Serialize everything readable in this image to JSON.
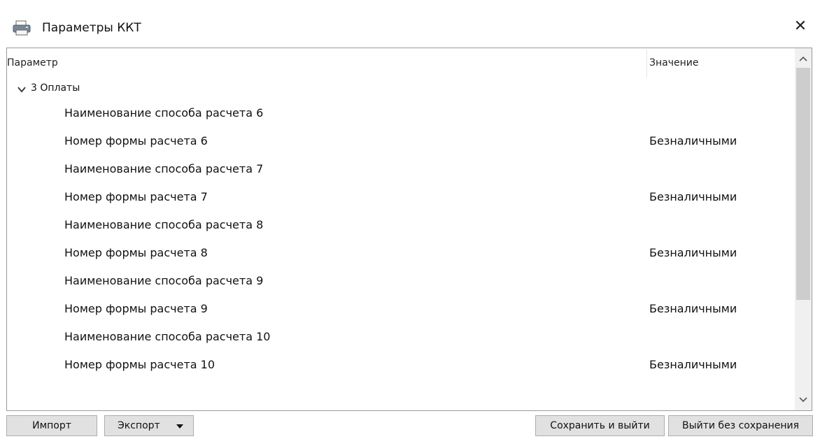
{
  "window": {
    "title": "Параметры ККТ",
    "icon": "printer-icon",
    "close_symbol": "✕"
  },
  "table": {
    "columns": {
      "param": "Параметр",
      "value": "Значение"
    },
    "group": {
      "label": "3 Оплаты",
      "expanded": true
    },
    "rows": [
      {
        "name": "Наименование способа расчета 6",
        "value": ""
      },
      {
        "name": "Номер формы расчета 6",
        "value": "Безналичными"
      },
      {
        "name": "Наименование способа расчета 7",
        "value": ""
      },
      {
        "name": "Номер формы расчета 7",
        "value": "Безналичными"
      },
      {
        "name": "Наименование способа расчета 8",
        "value": ""
      },
      {
        "name": "Номер формы расчета 8",
        "value": "Безналичными"
      },
      {
        "name": "Наименование способа расчета 9",
        "value": ""
      },
      {
        "name": "Номер формы расчета 9",
        "value": "Безналичными"
      },
      {
        "name": "Наименование способа расчета 10",
        "value": ""
      },
      {
        "name": "Номер формы расчета 10",
        "value": "Безналичными"
      }
    ]
  },
  "buttons": {
    "import": "Импорт",
    "export": "Экспорт",
    "save_exit": "Сохранить и выйти",
    "exit_no_save": "Выйти без сохранения"
  },
  "colors": {
    "button_bg": "#e1e1e1",
    "scroll_thumb": "#cdcdcd",
    "border": "#9a9a9a"
  }
}
